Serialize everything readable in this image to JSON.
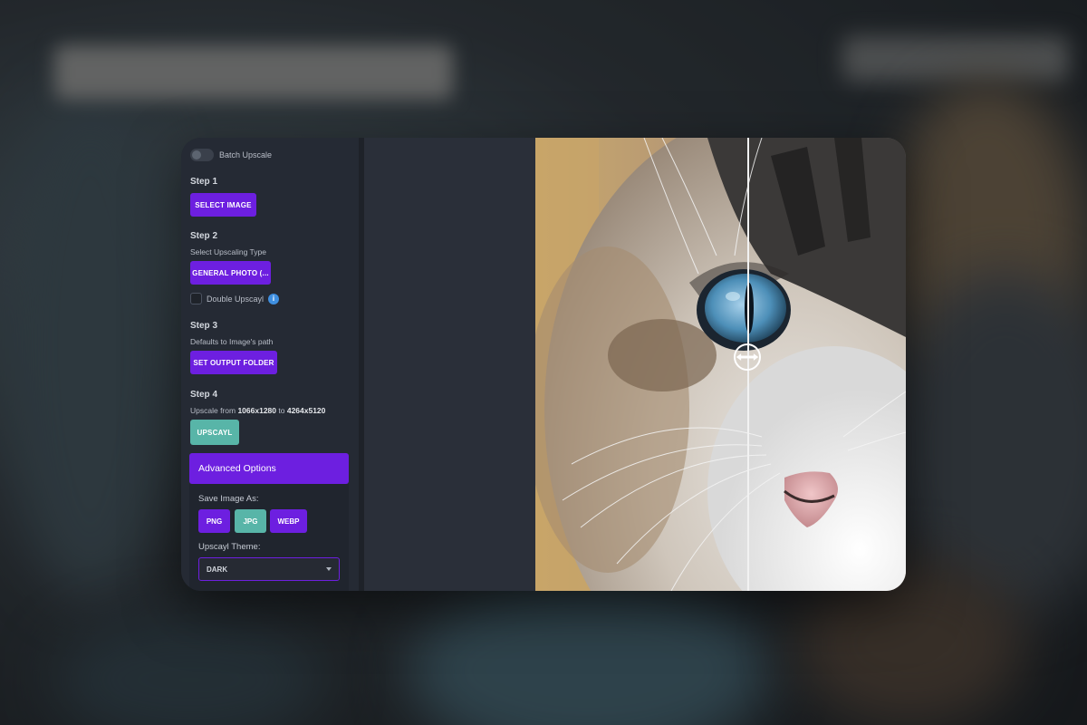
{
  "sidebar": {
    "batch_label": "Batch Upscale",
    "step1": {
      "title": "Step 1",
      "button": "SELECT IMAGE"
    },
    "step2": {
      "title": "Step 2",
      "desc": "Select Upscaling Type",
      "button": "GENERAL PHOTO (...",
      "double_label": "Double Upscayl",
      "info": "i"
    },
    "step3": {
      "title": "Step 3",
      "desc": "Defaults to Image's path",
      "button": "SET OUTPUT FOLDER"
    },
    "step4": {
      "title": "Step 4",
      "desc_prefix": "Upscale from",
      "from": "1066x1280",
      "to_word": "to",
      "to": "4264x5120",
      "button": "UPSCAYL"
    }
  },
  "advanced": {
    "header": "Advanced Options",
    "save_as_label": "Save Image As:",
    "formats": [
      "PNG",
      "JPG",
      "WEBP"
    ],
    "selected_format": "JPG",
    "theme_label": "Upscayl Theme:",
    "theme_value": "DARK"
  },
  "colors": {
    "accent": "#6d1fe0",
    "teal": "#58b5a8",
    "sidebar_bg": "#252a34"
  },
  "icons": [
    "compare-handle-icon",
    "info-icon",
    "caret-down-icon"
  ]
}
